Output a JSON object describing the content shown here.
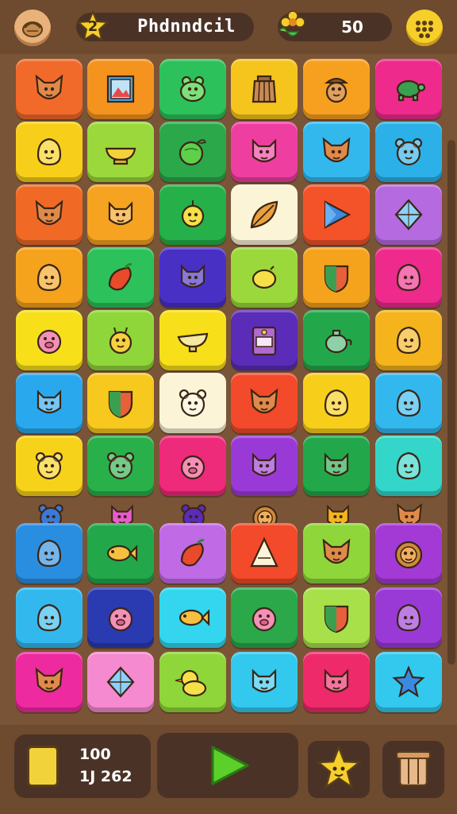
{
  "header": {
    "level": "2",
    "title": "Phdnndcil",
    "score": "50"
  },
  "board": {
    "rows": [
      [
        {
          "color": "#f26a2a",
          "icon": "fox-face"
        },
        {
          "color": "#f5931f",
          "icon": "picture-frame"
        },
        {
          "color": "#2cc15a",
          "icon": "frog-face"
        },
        {
          "color": "#f5c51d",
          "icon": "basket"
        },
        {
          "color": "#f7a020",
          "icon": "acorn-face"
        },
        {
          "color": "#ee2a8c",
          "icon": "turtle"
        }
      ],
      [
        {
          "color": "#f7cf1a",
          "icon": "blob-face"
        },
        {
          "color": "#9bd83c",
          "icon": "bowl"
        },
        {
          "color": "#2aa84a",
          "icon": "melon"
        },
        {
          "color": "#ee3fa0",
          "icon": "cat-face"
        },
        {
          "color": "#33b8ee",
          "icon": "fox-face"
        },
        {
          "color": "#2bb0e8",
          "icon": "bear-face"
        }
      ],
      [
        {
          "color": "#f06a26",
          "icon": "fox-face"
        },
        {
          "color": "#f5a321",
          "icon": "cat-face"
        },
        {
          "color": "#25b04a",
          "icon": "chick-face"
        },
        {
          "color": "#fbf4d6",
          "icon": "leaf"
        },
        {
          "color": "#f4532a",
          "icon": "triangle-gem"
        },
        {
          "color": "#b56ae0",
          "icon": "diamond-gem"
        }
      ],
      [
        {
          "color": "#f5a31c",
          "icon": "blob-face"
        },
        {
          "color": "#2cc15a",
          "icon": "chili"
        },
        {
          "color": "#4830c4",
          "icon": "cat-face"
        },
        {
          "color": "#9bd83c",
          "icon": "lemon"
        },
        {
          "color": "#f5a31c",
          "icon": "shield"
        },
        {
          "color": "#ee2a8c",
          "icon": "blob-face"
        }
      ],
      [
        {
          "color": "#f7df1a",
          "icon": "pig-face"
        },
        {
          "color": "#8fd63a",
          "icon": "giraffe-face"
        },
        {
          "color": "#f7df1a",
          "icon": "gravy-boat"
        },
        {
          "color": "#5a2cb8",
          "icon": "ticket"
        },
        {
          "color": "#22a84a",
          "icon": "teapot"
        },
        {
          "color": "#f5b31c",
          "icon": "blob-face"
        }
      ],
      [
        {
          "color": "#2aa8ee",
          "icon": "cat-face"
        },
        {
          "color": "#f7c81d",
          "icon": "shield"
        },
        {
          "color": "#fbf4d6",
          "icon": "bear-face"
        },
        {
          "color": "#f24a2a",
          "icon": "fox-face"
        },
        {
          "color": "#f7cf1a",
          "icon": "blob-face"
        },
        {
          "color": "#33b8ee",
          "icon": "blob-face"
        }
      ],
      [
        {
          "color": "#f7d21a",
          "icon": "bear-face"
        },
        {
          "color": "#2ab04a",
          "icon": "bear-face"
        },
        {
          "color": "#ee2a7a",
          "icon": "pig-face"
        },
        {
          "color": "#9a3ad6",
          "icon": "cat-face"
        },
        {
          "color": "#22a84a",
          "icon": "cat-face"
        },
        {
          "color": "#33d6c8",
          "icon": "blob-face"
        }
      ],
      [
        {
          "color": "#2a8ee0",
          "icon": "blob-face"
        },
        {
          "color": "#22a84a",
          "icon": "fish"
        },
        {
          "color": "#c06ae6",
          "icon": "chili"
        },
        {
          "color": "#f24a2a",
          "icon": "cone"
        },
        {
          "color": "#8fd63a",
          "icon": "fox-face"
        },
        {
          "color": "#a33ad6",
          "icon": "lion"
        }
      ],
      [
        {
          "color": "#33b8ee",
          "icon": "blob-face"
        },
        {
          "color": "#2a3ab0",
          "icon": "pig-face"
        },
        {
          "color": "#33d6ee",
          "icon": "fish"
        },
        {
          "color": "#2aa84a",
          "icon": "pig-face"
        },
        {
          "color": "#a8e04a",
          "icon": "shield"
        },
        {
          "color": "#9a3ad6",
          "icon": "blob-face"
        }
      ],
      [
        {
          "color": "#ee2aa0",
          "icon": "fox-face"
        },
        {
          "color": "#f58ad0",
          "icon": "diamond-gem"
        },
        {
          "color": "#8fd63a",
          "icon": "duck"
        },
        {
          "color": "#33c8ee",
          "icon": "cat-face"
        },
        {
          "color": "#ee2a6a",
          "icon": "cat-face"
        },
        {
          "color": "#33c8ee",
          "icon": "star"
        }
      ]
    ],
    "peek_row": [
      {
        "color": "#3a7ad6",
        "icon": "bear-face"
      },
      {
        "color": "#e65acb",
        "icon": "cat-face"
      },
      {
        "color": "#5a2cb8",
        "icon": "bear-face"
      },
      {
        "color": "#f5c51d",
        "icon": "lion"
      },
      {
        "color": "#f5b31c",
        "icon": "cat-face"
      },
      {
        "color": "#f0642a",
        "icon": "fox-face"
      }
    ]
  },
  "footer": {
    "stat_top": "100",
    "stat_bottom": "1J 262"
  },
  "colors": {
    "background": "#7a5436",
    "panel": "#4a3326",
    "accent_yellow": "#f6cf2a",
    "play_green": "#5cd02a"
  }
}
